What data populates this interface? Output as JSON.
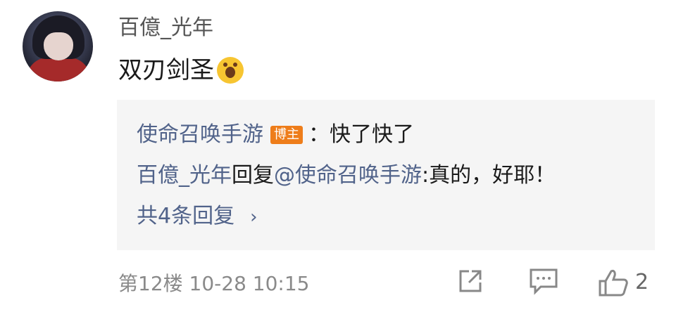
{
  "comment": {
    "username": "百億_光年",
    "text": "双刃剑圣",
    "emoji": "crying-laughing-emoji"
  },
  "replies": {
    "line1": {
      "author": "使命召唤手游",
      "badge": "博主",
      "separator": "：",
      "text": "快了快了"
    },
    "line2": {
      "author": "百億_光年",
      "action": "回复",
      "mention": "@使命召唤手游",
      "text": ":真的，好耶！"
    },
    "more": {
      "label": "共4条回复",
      "chevron": "›"
    }
  },
  "meta": {
    "floor_time": "第12楼 10-28 10:15"
  },
  "actions": {
    "like_count": "2"
  },
  "colors": {
    "link": "#51638a",
    "badge": "#ee7d1a",
    "reply_bg": "#f5f5f5"
  }
}
